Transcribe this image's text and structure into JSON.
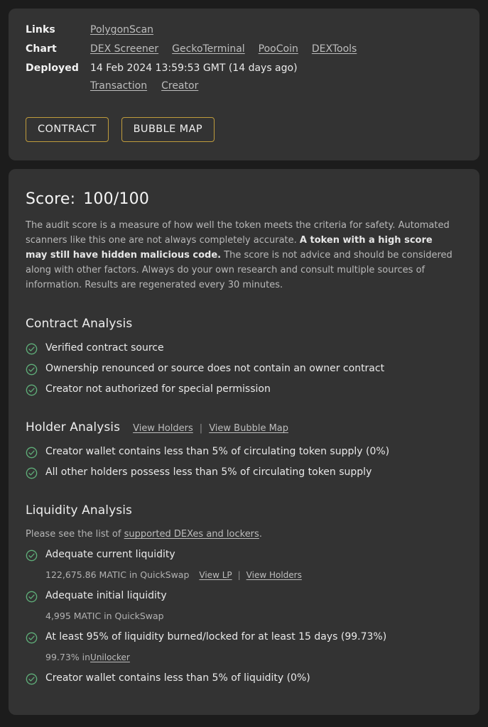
{
  "info_card": {
    "rows": [
      {
        "label": "Links",
        "links": [
          {
            "text": "PolygonScan"
          }
        ]
      },
      {
        "label": "Chart",
        "links": [
          {
            "text": "DEX Screener"
          },
          {
            "text": "GeckoTerminal"
          },
          {
            "text": "PooCoin"
          },
          {
            "text": "DEXTools"
          }
        ]
      }
    ],
    "deployed": {
      "label": "Deployed",
      "value": "14 Feb 2024 13:59:53 GMT (14 days ago)",
      "sub_links": [
        {
          "text": "Transaction"
        },
        {
          "text": "Creator"
        }
      ]
    },
    "buttons": [
      {
        "text": "CONTRACT"
      },
      {
        "text": "BUBBLE MAP"
      }
    ],
    "button_border_color": "#bf9c3c"
  },
  "audit_card": {
    "score_label": "Score:",
    "score_value": "100/100",
    "description": {
      "part1": "The audit score is a measure of how well the token meets the criteria for safety.  Automated scanners like this one are not always completely accurate. ",
      "bold": " A token with a high score may still have hidden malicious code.",
      "part2": " The score is not advice and should be considered along with other factors. Always do your own research and consult multiple sources of information.  Results are regenerated every 30 minutes."
    },
    "contract_analysis": {
      "title": "Contract Analysis",
      "items": [
        {
          "status": "pass",
          "text": "Verified contract source"
        },
        {
          "status": "pass",
          "text": "Ownership renounced or source does not contain an owner contract"
        },
        {
          "status": "pass",
          "text": "Creator not authorized for special permission"
        }
      ]
    },
    "holder_analysis": {
      "title": "Holder Analysis",
      "head_links": [
        {
          "text": "View Holders"
        },
        {
          "text": "View Bubble Map"
        }
      ],
      "separator": "|",
      "items": [
        {
          "status": "pass",
          "text": "Creator wallet contains less than 5% of circulating token supply (0%)"
        },
        {
          "status": "pass",
          "text": "All other holders possess less than 5% of circulating token supply"
        }
      ]
    },
    "liquidity_analysis": {
      "title": "Liquidity Analysis",
      "note_prefix": "Please see the list of ",
      "note_link": "supported DEXes and lockers",
      "note_suffix": ".",
      "items": [
        {
          "status": "pass",
          "text": "Adequate current liquidity",
          "detail": "122,675.86 MATIC in QuickSwap",
          "detail_links": [
            {
              "text": "View LP"
            },
            {
              "text": "View Holders"
            }
          ],
          "detail_separator": "|"
        },
        {
          "status": "pass",
          "text": "Adequate initial liquidity",
          "detail": "4,995 MATIC in QuickSwap",
          "detail_links": [],
          "detail_separator": ""
        },
        {
          "status": "pass",
          "text": "At least 95% of liquidity burned/locked for at least 15 days (99.73%)",
          "detail_prefix": "99.73% in ",
          "detail_link": "Unilocker",
          "detail_links": [],
          "detail_separator": ""
        },
        {
          "status": "pass",
          "text": "Creator wallet contains less than 5% of liquidity (0%)",
          "detail": "",
          "detail_links": [],
          "detail_separator": ""
        }
      ]
    }
  },
  "colors": {
    "page_background": "#1c1c1c",
    "card_background": "#333333",
    "accent_gold": "#bf9c3c",
    "pass_green": "#5fae79",
    "link_gray": "#bdbdbd"
  }
}
